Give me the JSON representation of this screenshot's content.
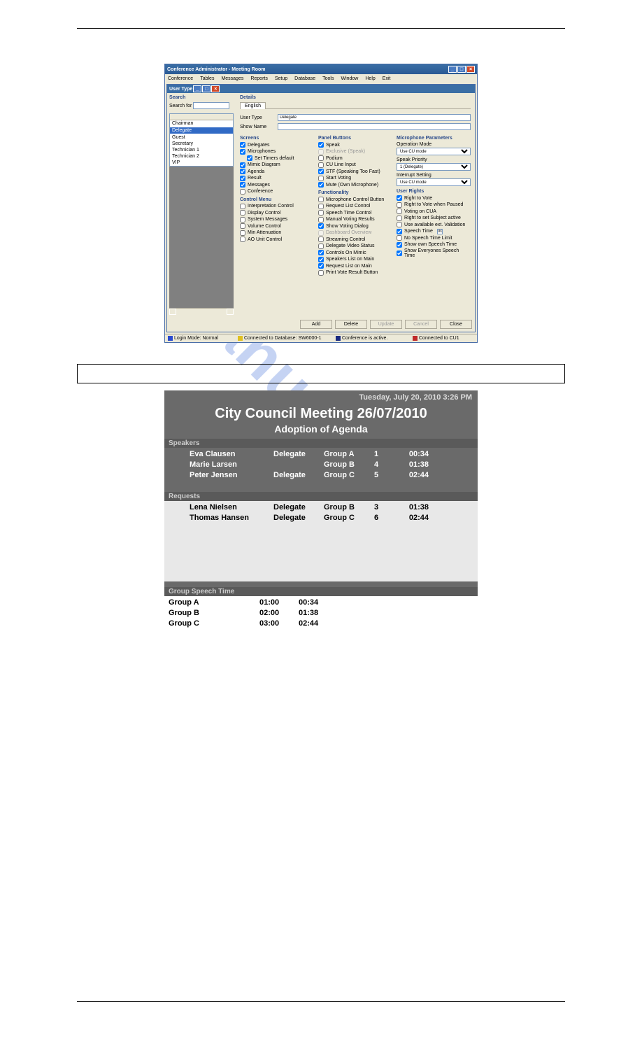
{
  "admin_window": {
    "title": "Conference Administrator - Meeting Room",
    "menubar": [
      "Conference",
      "Tables",
      "Messages",
      "Reports",
      "Setup",
      "Database",
      "Tools",
      "Window",
      "Help",
      "Exit"
    ],
    "subwindow_title": "User Type",
    "search_header": "Search",
    "search_label": "Search for",
    "list_items": [
      "Chairman",
      "Delegate",
      "Guest",
      "Secretary",
      "Technician 1",
      "Technician 2",
      "VIP"
    ],
    "selected_index": 1,
    "details_header": "Details",
    "tab_label": "English",
    "user_type_label": "User Type",
    "user_type_value": "Delegate",
    "show_name_label": "Show Name",
    "show_name_value": "",
    "screens_header": "Screens",
    "screens": [
      {
        "label": "Delegates",
        "checked": true
      },
      {
        "label": "Microphones",
        "checked": true
      },
      {
        "label": "Set Timers default",
        "checked": true,
        "indent": true
      },
      {
        "label": "Mimic Diagram",
        "checked": true
      },
      {
        "label": "Agenda",
        "checked": true
      },
      {
        "label": "Result",
        "checked": true
      },
      {
        "label": "Messages",
        "checked": true
      },
      {
        "label": "Conference",
        "checked": false
      }
    ],
    "control_header": "Control Menu",
    "control": [
      {
        "label": "Interpretation Control",
        "checked": false
      },
      {
        "label": "Display Control",
        "checked": false
      },
      {
        "label": "System Messages",
        "checked": false
      },
      {
        "label": "Volume Control",
        "checked": false
      },
      {
        "label": "Min Attenuation",
        "checked": false
      },
      {
        "label": "AO Unit Control",
        "checked": false
      }
    ],
    "panel_header": "Panel Buttons",
    "panel": [
      {
        "label": "Speak",
        "checked": true
      },
      {
        "label": "Exclusive (Speak)",
        "checked": false,
        "disabled": true
      },
      {
        "label": "Podium",
        "checked": false
      },
      {
        "label": "CU Line Input",
        "checked": false
      },
      {
        "label": "STF (Speaking Too Fast)",
        "checked": true
      },
      {
        "label": "Start Voting",
        "checked": false
      },
      {
        "label": "Mute (Own Microphone)",
        "checked": true
      }
    ],
    "func_header": "Functionality",
    "func": [
      {
        "label": "Microphone Control Button",
        "checked": false
      },
      {
        "label": "Request List Control",
        "checked": false
      },
      {
        "label": "Speech Time Control",
        "checked": false
      },
      {
        "label": "Manual Voting Results",
        "checked": false
      },
      {
        "label": "Show Voting Dialog",
        "checked": true
      },
      {
        "label": "Dashboard Overview",
        "checked": false,
        "disabled": true
      },
      {
        "label": "Streaming Control",
        "checked": false
      },
      {
        "label": "Delegate Video Status",
        "checked": false
      },
      {
        "label": "Controls On Mimic",
        "checked": true
      },
      {
        "label": "Speakers List on Main",
        "checked": true
      },
      {
        "label": "Request List on Main",
        "checked": true
      },
      {
        "label": "Print Vote Result Button",
        "checked": false
      }
    ],
    "mic_header": "Microphone Parameters",
    "mic_op_label": "Operation Mode",
    "mic_op_value": "Use CU mode",
    "mic_sp_label": "Speak Priority",
    "mic_sp_value": "1 (Delegate)",
    "mic_int_label": "Interrupt Setting",
    "mic_int_value": "Use CU mode",
    "rights_header": "User Rights",
    "rights": [
      {
        "label": "Right to Vote",
        "checked": true
      },
      {
        "label": "Right to Vote when Paused",
        "checked": false
      },
      {
        "label": "Voting on CUA",
        "checked": false
      },
      {
        "label": "Right to set Subject active",
        "checked": false
      },
      {
        "label": "Use available ext. Validation",
        "checked": false
      },
      {
        "label": "Speech Time",
        "checked": true,
        "input": "00:00:30"
      },
      {
        "label": "No Speech Time Limit",
        "checked": false
      },
      {
        "label": "Show own Speech Time",
        "checked": true
      },
      {
        "label": "Show Everyones Speech Time",
        "checked": true
      }
    ],
    "buttons": {
      "add": "Add",
      "delete": "Delete",
      "update": "Update",
      "cancel": "Cancel",
      "close": "Close"
    },
    "status": {
      "login": "Login Mode: Normal",
      "db": "Connected to Database: SW6000-1",
      "conf": "Conference is active.",
      "cu": "Connected to CU1"
    }
  },
  "display_screen": {
    "datetime": "Tuesday, July 20, 2010 3:26 PM",
    "title": "City Council Meeting 26/07/2010",
    "subtitle": "Adoption of Agenda",
    "speakers_header": "Speakers",
    "speakers": [
      {
        "name": "Eva Clausen",
        "role": "Delegate",
        "group": "Group A",
        "num": "1",
        "time": "00:34"
      },
      {
        "name": "Marie Larsen",
        "role": "",
        "group": "Group B",
        "num": "4",
        "time": "01:38"
      },
      {
        "name": "Peter Jensen",
        "role": "Delegate",
        "group": "Group C",
        "num": "5",
        "time": "02:44"
      }
    ],
    "requests_header": "Requests",
    "requests": [
      {
        "name": "Lena Nielsen",
        "role": "Delegate",
        "group": "Group B",
        "num": "3",
        "time": "01:38"
      },
      {
        "name": "Thomas Hansen",
        "role": "Delegate",
        "group": "Group C",
        "num": "6",
        "time": "02:44"
      }
    ],
    "gst_header": "Group Speech Time",
    "gst": [
      {
        "group": "Group A",
        "t1": "01:00",
        "t2": "00:34"
      },
      {
        "group": "Group B",
        "t1": "02:00",
        "t2": "01:38"
      },
      {
        "group": "Group C",
        "t1": "03:00",
        "t2": "02:44"
      }
    ]
  },
  "watermark": "manualshive"
}
